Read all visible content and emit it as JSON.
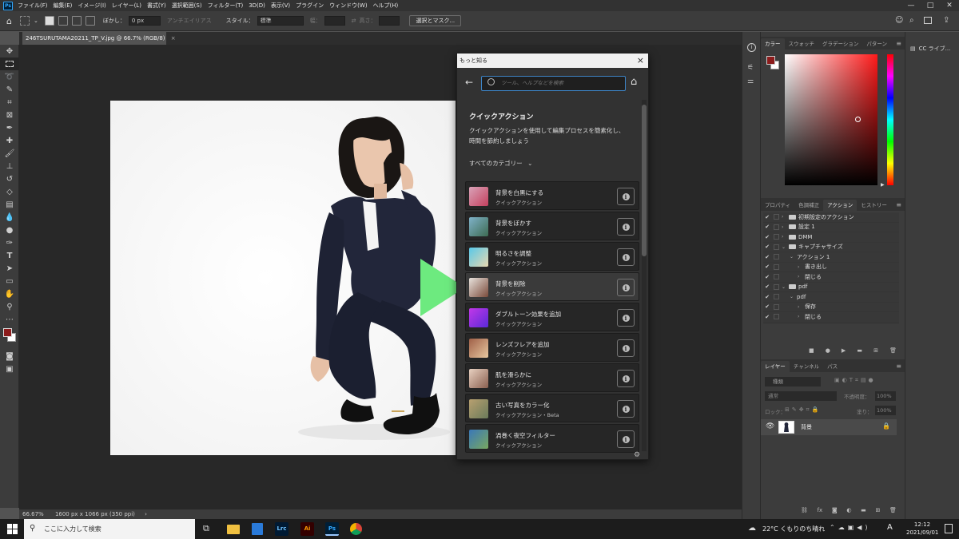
{
  "app": {
    "icon_label": "Ps"
  },
  "menubar": [
    "ファイル(F)",
    "編集(E)",
    "イメージ(I)",
    "レイヤー(L)",
    "書式(Y)",
    "選択範囲(S)",
    "フィルター(T)",
    "3D(D)",
    "表示(V)",
    "プラグイン",
    "ウィンドウ(W)",
    "ヘルプ(H)"
  ],
  "options_bar": {
    "feather_label": "ぼかし：",
    "feather_value": "0 px",
    "antialias_label": "アンチエイリアス",
    "style_label": "スタイル：",
    "style_value": "標準",
    "width_label": "幅：",
    "height_label": "高さ：",
    "select_mask_button": "選択とマスク..."
  },
  "document": {
    "tab_title": "246TSURUTAMA20211_TP_V.jpg @ 66.7% (RGB/8)",
    "tab_close": "×",
    "zoom": "66.67%",
    "doc_info": "1600 px x 1066 px (350 ppi)",
    "status_arrow": "›"
  },
  "discover_panel": {
    "title": "もっと知る",
    "close": "×",
    "search_placeholder": "ツール、ヘルプなどを検索",
    "heading": "クイックアクション",
    "description": "クイックアクションを使用して編集プロセスを簡素化し、時間を節約しましょう",
    "category_filter": "すべてのカテゴリー",
    "actions": [
      {
        "name": "背景を白黒にする",
        "sub": "クイックアクション",
        "c1": "#d9a3b8",
        "c2": "#c4405e"
      },
      {
        "name": "背景をぼかす",
        "sub": "クイックアクション",
        "c1": "#7fb2c9",
        "c2": "#3d6b52"
      },
      {
        "name": "明るさを調整",
        "sub": "クイックアクション",
        "c1": "#58c8e8",
        "c2": "#e8d8b0"
      },
      {
        "name": "背景を削除",
        "sub": "クイックアクション",
        "c1": "#e8e2dc",
        "c2": "#7a4a3a"
      },
      {
        "name": "ダブルトーン効果を追加",
        "sub": "クイックアクション",
        "c1": "#c238e8",
        "c2": "#5a2ad8"
      },
      {
        "name": "レンズフレアを追加",
        "sub": "クイックアクション",
        "c1": "#a06048",
        "c2": "#e8c8a0"
      },
      {
        "name": "肌を滑らかに",
        "sub": "クイックアクション",
        "c1": "#e8d0c0",
        "c2": "#8a6050"
      },
      {
        "name": "古い写真をカラー化",
        "sub": "クイックアクション・Beta",
        "c1": "#b8a070",
        "c2": "#6a7a5a"
      },
      {
        "name": "渦巻く夜空フィルター",
        "sub": "クイックアクション",
        "c1": "#3a78b8",
        "c2": "#78a860"
      }
    ]
  },
  "color_panel": {
    "tabs": [
      "カラー",
      "スウォッチ",
      "グラデーション",
      "パターン"
    ],
    "active_tab": 0,
    "foreground_color": "#8c1c1c",
    "hue_color": "#ff1a1a"
  },
  "actions_panel": {
    "tabs": [
      "プロパティ",
      "色調補正",
      "アクション",
      "ヒストリー"
    ],
    "active_tab": 2,
    "items": [
      {
        "label": "初期設定のアクション",
        "indent": 0,
        "type": "folder"
      },
      {
        "label": "設定 1",
        "indent": 0,
        "type": "folder"
      },
      {
        "label": "DMM",
        "indent": 0,
        "type": "folder"
      },
      {
        "label": "キャプチャサイズ",
        "indent": 0,
        "type": "folder-open"
      },
      {
        "label": "アクション 1",
        "indent": 1,
        "type": "action-open"
      },
      {
        "label": "書き出し",
        "indent": 2,
        "type": "step"
      },
      {
        "label": "閉じる",
        "indent": 2,
        "type": "step"
      },
      {
        "label": "pdf",
        "indent": 0,
        "type": "folder-open"
      },
      {
        "label": "pdf",
        "indent": 1,
        "type": "action-open"
      },
      {
        "label": "保存",
        "indent": 2,
        "type": "step"
      },
      {
        "label": "閉じる",
        "indent": 2,
        "type": "step"
      }
    ]
  },
  "layers_panel": {
    "tabs": [
      "レイヤー",
      "チャンネル",
      "パス"
    ],
    "active_tab": 0,
    "filter_label": "種類",
    "blend_mode": "通常",
    "opacity_label": "不透明度：",
    "opacity_value": "100%",
    "lock_label": "ロック：",
    "fill_label": "塗り：",
    "fill_value": "100%",
    "layers": [
      {
        "name": "背景"
      }
    ]
  },
  "libraries_panel": {
    "label": "CC ライブ..."
  },
  "taskbar": {
    "search_placeholder": "ここに入力して検索",
    "apps": [
      "Lrc",
      "Ai",
      "Ps"
    ],
    "weather": "22°C くもりのち晴れ",
    "ime": "A",
    "time": "12:12",
    "date": "2021/09/01"
  }
}
